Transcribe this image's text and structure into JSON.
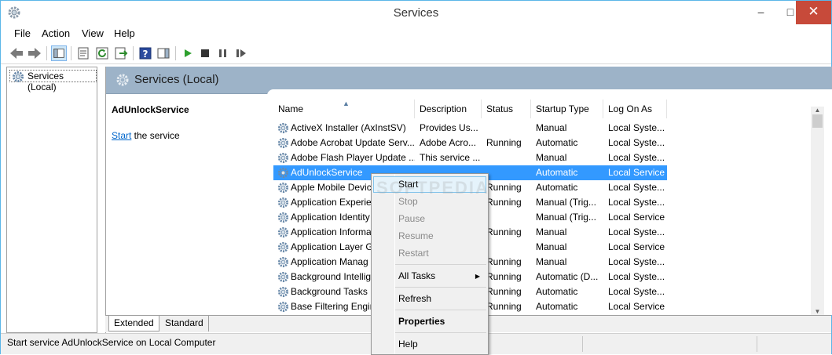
{
  "window": {
    "title": "Services"
  },
  "title_buttons": {
    "minimize": "–",
    "maximize": "□",
    "close": "✕"
  },
  "menubar": [
    {
      "label": "File"
    },
    {
      "label": "Action"
    },
    {
      "label": "View"
    },
    {
      "label": "Help"
    }
  ],
  "toolbar": {
    "icons": [
      "back-icon",
      "forward-icon",
      "show-hide-console-tree-icon",
      "properties-icon",
      "refresh-icon",
      "export-list-icon",
      "help-icon",
      "action-pane-icon",
      "start-icon",
      "stop-icon",
      "pause-icon",
      "restart-icon"
    ]
  },
  "tree": {
    "root_label": "Services (Local)"
  },
  "header": {
    "title": "Services (Local)"
  },
  "description": {
    "service_name": "AdUnlockService",
    "link_text": "Start",
    "link_suffix": " the service"
  },
  "columns": [
    "Name",
    "Description",
    "Status",
    "Startup Type",
    "Log On As"
  ],
  "sorted_column": "Name",
  "rows": [
    {
      "name": "ActiveX Installer (AxInstSV)",
      "description": "Provides Us...",
      "status": "",
      "startup": "Manual",
      "logon": "Local Syste..."
    },
    {
      "name": "Adobe Acrobat Update Serv...",
      "description": "Adobe Acro...",
      "status": "Running",
      "startup": "Automatic",
      "logon": "Local Syste..."
    },
    {
      "name": "Adobe Flash Player Update ...",
      "description": "This service ...",
      "status": "",
      "startup": "Manual",
      "logon": "Local Syste..."
    },
    {
      "name": "AdUnlockService",
      "description": "",
      "status": "",
      "startup": "Automatic",
      "logon": "Local Service",
      "selected": true
    },
    {
      "name": "Apple Mobile Devic",
      "description": "",
      "status": "Running",
      "startup": "Automatic",
      "logon": "Local Syste..."
    },
    {
      "name": "Application Experie",
      "description": "",
      "status": "Running",
      "startup": "Manual (Trig...",
      "logon": "Local Syste..."
    },
    {
      "name": "Application Identity",
      "description": "",
      "status": "",
      "startup": "Manual (Trig...",
      "logon": "Local Service"
    },
    {
      "name": "Application Informa",
      "description": "",
      "status": "Running",
      "startup": "Manual",
      "logon": "Local Syste..."
    },
    {
      "name": "Application Layer G",
      "description": "",
      "status": "",
      "startup": "Manual",
      "logon": "Local Service"
    },
    {
      "name": "Application Manag",
      "description": "",
      "status": "Running",
      "startup": "Manual",
      "logon": "Local Syste..."
    },
    {
      "name": "Background Intellig",
      "description": "",
      "status": "Running",
      "startup": "Automatic (D...",
      "logon": "Local Syste..."
    },
    {
      "name": "Background Tasks I",
      "description": "",
      "status": "Running",
      "startup": "Automatic",
      "logon": "Local Syste..."
    },
    {
      "name": "Base Filtering Engin",
      "description": "",
      "status": "Running",
      "startup": "Automatic",
      "logon": "Local Service"
    }
  ],
  "context_menu": {
    "items": [
      {
        "label": "Start",
        "state": "highlighted"
      },
      {
        "label": "Stop",
        "state": "disabled"
      },
      {
        "label": "Pause",
        "state": "disabled"
      },
      {
        "label": "Resume",
        "state": "disabled"
      },
      {
        "label": "Restart",
        "state": "disabled"
      },
      {
        "label": "All Tasks",
        "state": "submenu"
      },
      {
        "label": "Refresh",
        "state": "normal"
      },
      {
        "label": "Properties",
        "state": "bold"
      },
      {
        "label": "Help",
        "state": "normal"
      }
    ]
  },
  "bottom_tabs": [
    {
      "label": "Extended",
      "active": true
    },
    {
      "label": "Standard",
      "active": false
    }
  ],
  "statusbar": {
    "text": "Start service AdUnlockService on Local Computer"
  },
  "watermark": {
    "text": "SOFTPEDIA"
  },
  "colors": {
    "selection": "#3399ff",
    "header_band": "#9db3c8",
    "link": "#0066cc",
    "close_button": "#c74a3a"
  }
}
